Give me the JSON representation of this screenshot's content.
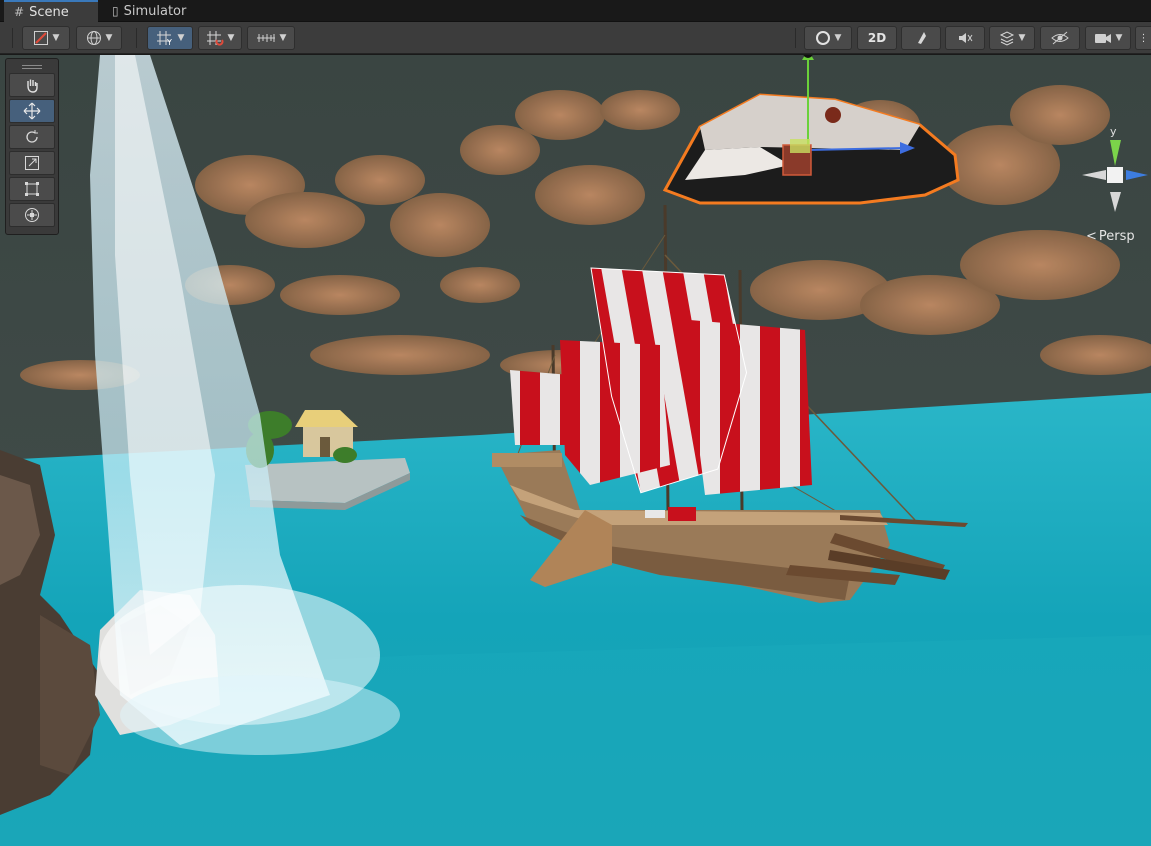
{
  "tabs": [
    {
      "label": "Scene",
      "icon": "hash-icon",
      "active": true
    },
    {
      "label": "Simulator",
      "icon": "phone-icon",
      "active": false
    }
  ],
  "toolbar": {
    "left_tools": [
      "draw-mode-icon",
      "globe-icon",
      "grid-snap-icon",
      "snap-increment-icon",
      "ruler-icon"
    ],
    "right_tools": [
      "render-mode-icon",
      "2d-toggle",
      "lighting-icon",
      "audio-mute-icon",
      "effects-icon",
      "visibility-icon",
      "camera-icon"
    ],
    "two_d_label": "2D"
  },
  "palette": {
    "tools": [
      "hand-tool",
      "move-tool",
      "rotate-tool",
      "scale-tool",
      "rect-tool",
      "transform-tool"
    ],
    "active_tool": "move-tool"
  },
  "gizmo": {
    "y_label": "y",
    "projection_label": "Persp"
  },
  "colors": {
    "accent": "#3a79bb",
    "selection_outline": "#f47b20",
    "water": "#1fa8be",
    "sky": "#3d4a47",
    "sail_red": "#c8101c",
    "sail_white": "#e8e6e6"
  }
}
